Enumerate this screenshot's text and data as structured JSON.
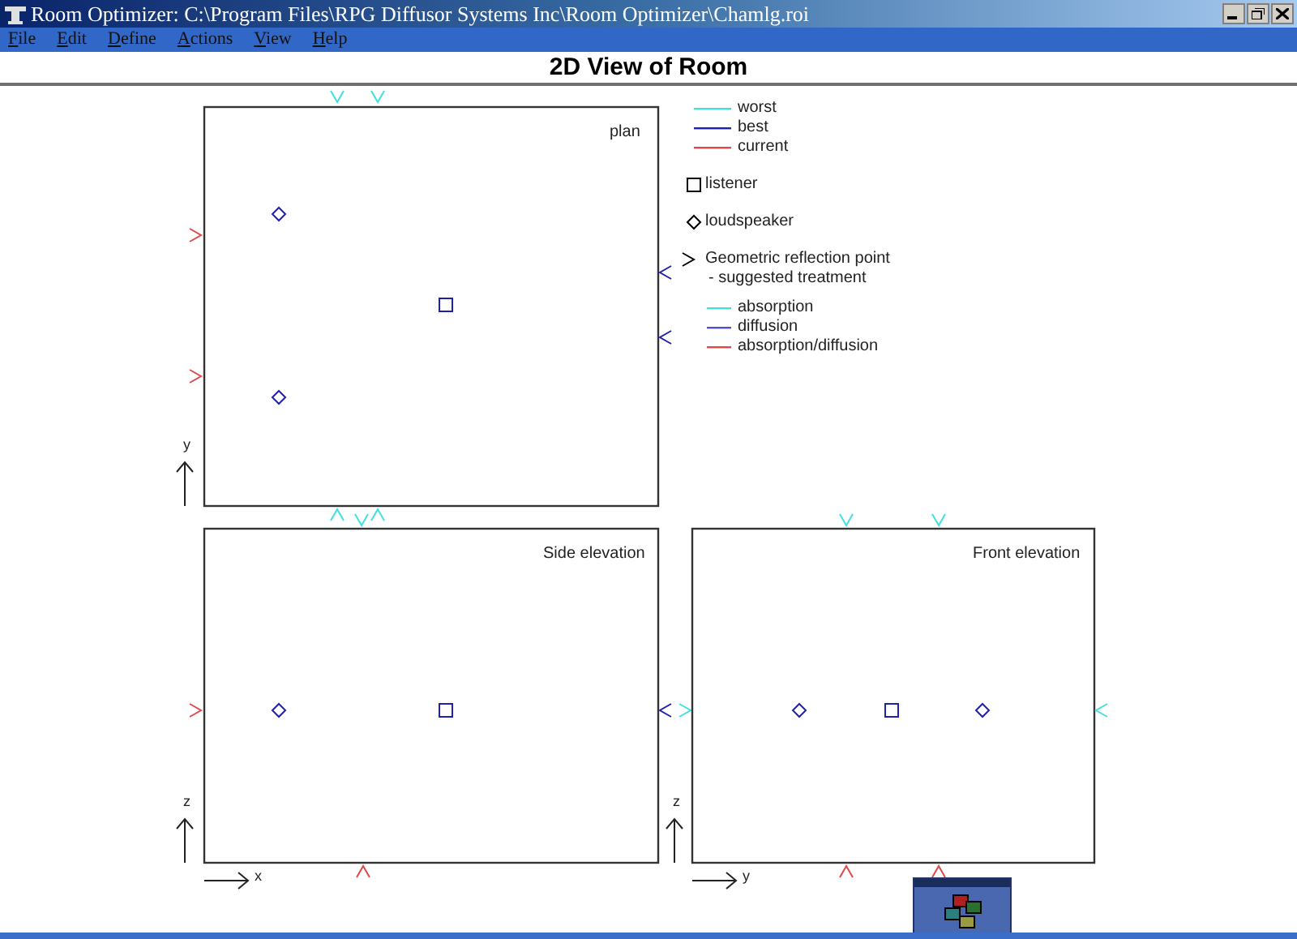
{
  "window": {
    "title": "Room Optimizer: C:\\Program Files\\RPG Diffusor Systems Inc\\Room Optimizer\\Chamlg.roi"
  },
  "menu": [
    "File",
    "Edit",
    "Define",
    "Actions",
    "View",
    "Help"
  ],
  "heading": "2D View of Room",
  "views": [
    {
      "kind": "plan",
      "label": "plan",
      "vertical_axis": "y"
    },
    {
      "kind": "side",
      "label": "Side elevation",
      "vertical_axis": "z",
      "horizontal_axis": "x"
    },
    {
      "kind": "front",
      "label": "Front elevation",
      "vertical_axis": "z",
      "horizontal_axis": "y"
    }
  ],
  "legend": {
    "lines": [
      {
        "label": "worst",
        "color": "#40e0e0"
      },
      {
        "label": "best",
        "color": "#2020b0"
      },
      {
        "label": "current",
        "color": "#e04848"
      }
    ],
    "symbols": [
      {
        "kind": "square",
        "label": "listener"
      },
      {
        "kind": "diamond",
        "label": "loudspeaker"
      },
      {
        "kind": "chevron",
        "label": "Geometric reflection point",
        "note": "- suggested treatment"
      }
    ],
    "treatments": [
      {
        "label": "absorption",
        "color": "#40e0e0"
      },
      {
        "label": "diffusion",
        "color": "#5050c8"
      },
      {
        "label": "absorption/diffusion",
        "color": "#e04848"
      }
    ]
  }
}
